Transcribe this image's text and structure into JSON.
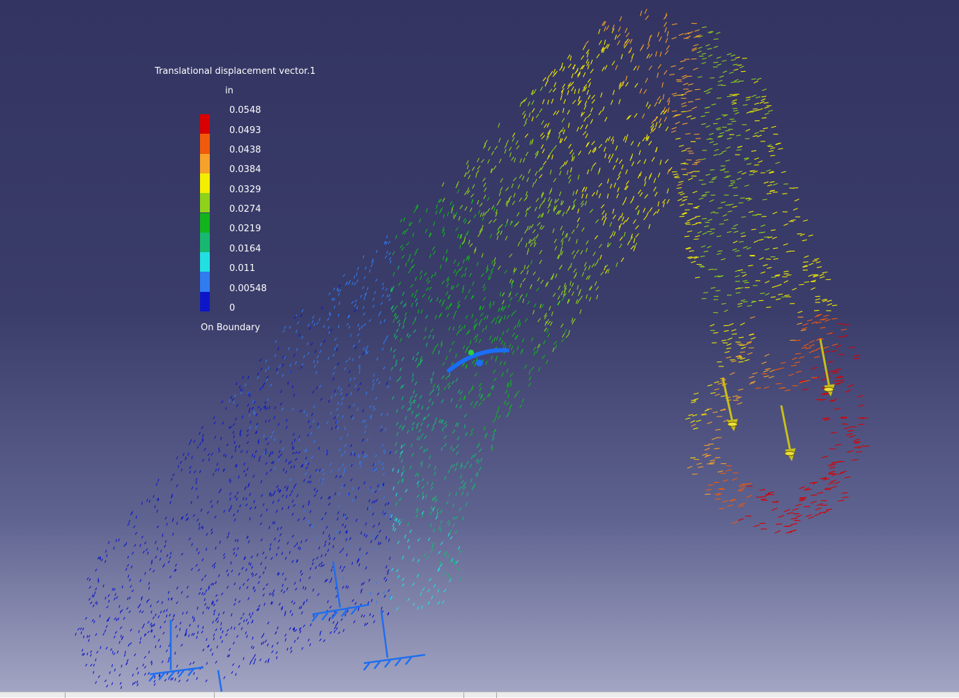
{
  "legend": {
    "title": "Translational displacement vector.1",
    "unit": "in",
    "values": [
      "0.0548",
      "0.0493",
      "0.0438",
      "0.0384",
      "0.0329",
      "0.0274",
      "0.0219",
      "0.0164",
      "0.011",
      "0.00548",
      "0"
    ],
    "colors": [
      "#d80000",
      "#f05a0a",
      "#f6a22a",
      "#f4ee00",
      "#8fd21a",
      "#12b41e",
      "#18b870",
      "#22e0e2",
      "#2f7cf0",
      "#0c16c8"
    ],
    "footer": "On Boundary"
  },
  "vector_field_colors": {
    "low": "#0c16c8",
    "mid_low": "#2f7cf0",
    "mid": "#22e0e2",
    "mid_high": "#12b41e",
    "high": "#f4ee00",
    "max": "#d80000"
  },
  "icons": {
    "restraint": "clamp-restraint-icon",
    "load": "force-arrow-icon",
    "compass": "rotation-compass-icon"
  }
}
